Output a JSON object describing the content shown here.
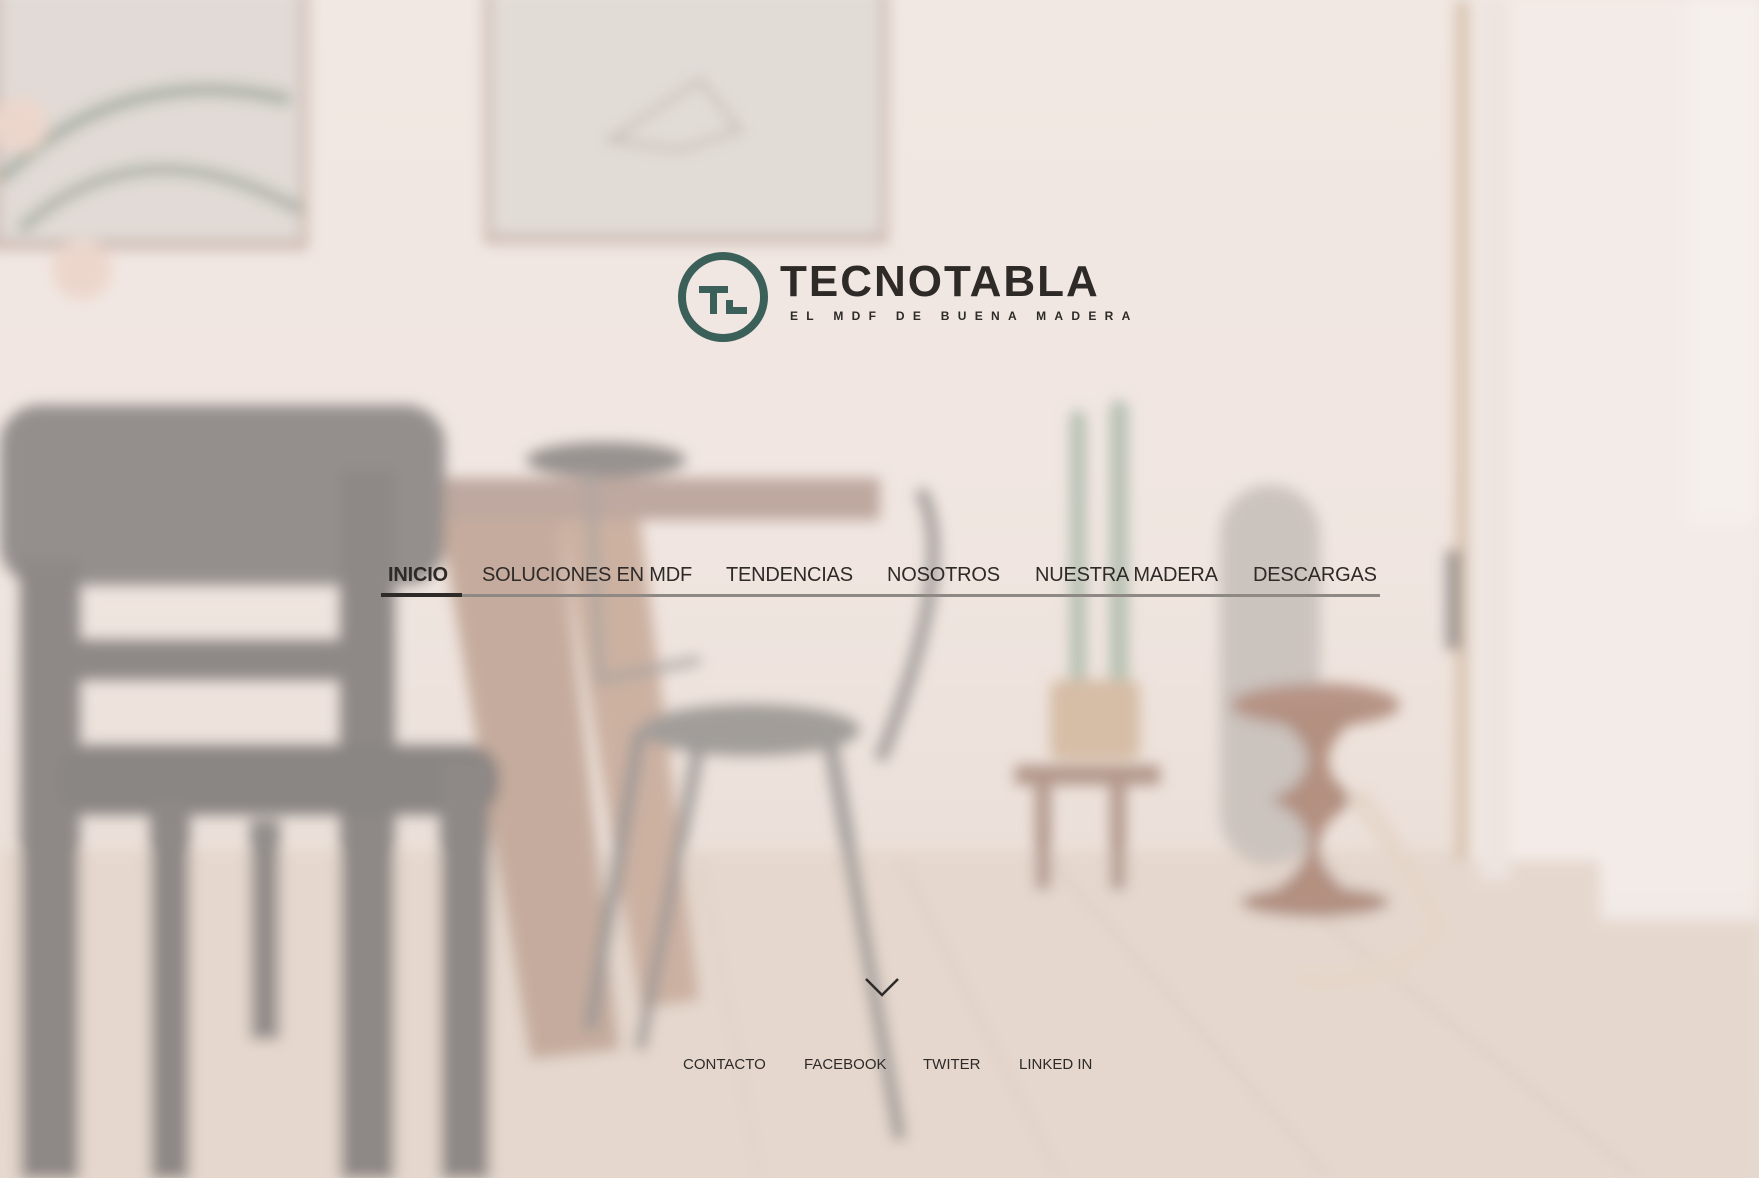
{
  "brand": {
    "name": "TECNOTABLA",
    "tagline": "EL MDF DE BUENA MADERA",
    "mark_icon": "tecnotabla-logo-icon",
    "colors": {
      "mark": "#3b5f59",
      "text": "#2e2a28"
    }
  },
  "nav": {
    "items": [
      {
        "label": "INICIO",
        "active": true
      },
      {
        "label": "SOLUCIONES EN MDF",
        "active": false
      },
      {
        "label": "TENDENCIAS",
        "active": false
      },
      {
        "label": "NOSOTROS",
        "active": false
      },
      {
        "label": "NUESTRA MADERA",
        "active": false
      },
      {
        "label": "DESCARGAS",
        "active": false
      }
    ]
  },
  "scroll": {
    "icon": "chevron-down-icon"
  },
  "footer": {
    "links": [
      {
        "label": "CONTACTO"
      },
      {
        "label": "FACEBOOK"
      },
      {
        "label": "TWITER"
      },
      {
        "label": "LINKED IN"
      }
    ]
  }
}
